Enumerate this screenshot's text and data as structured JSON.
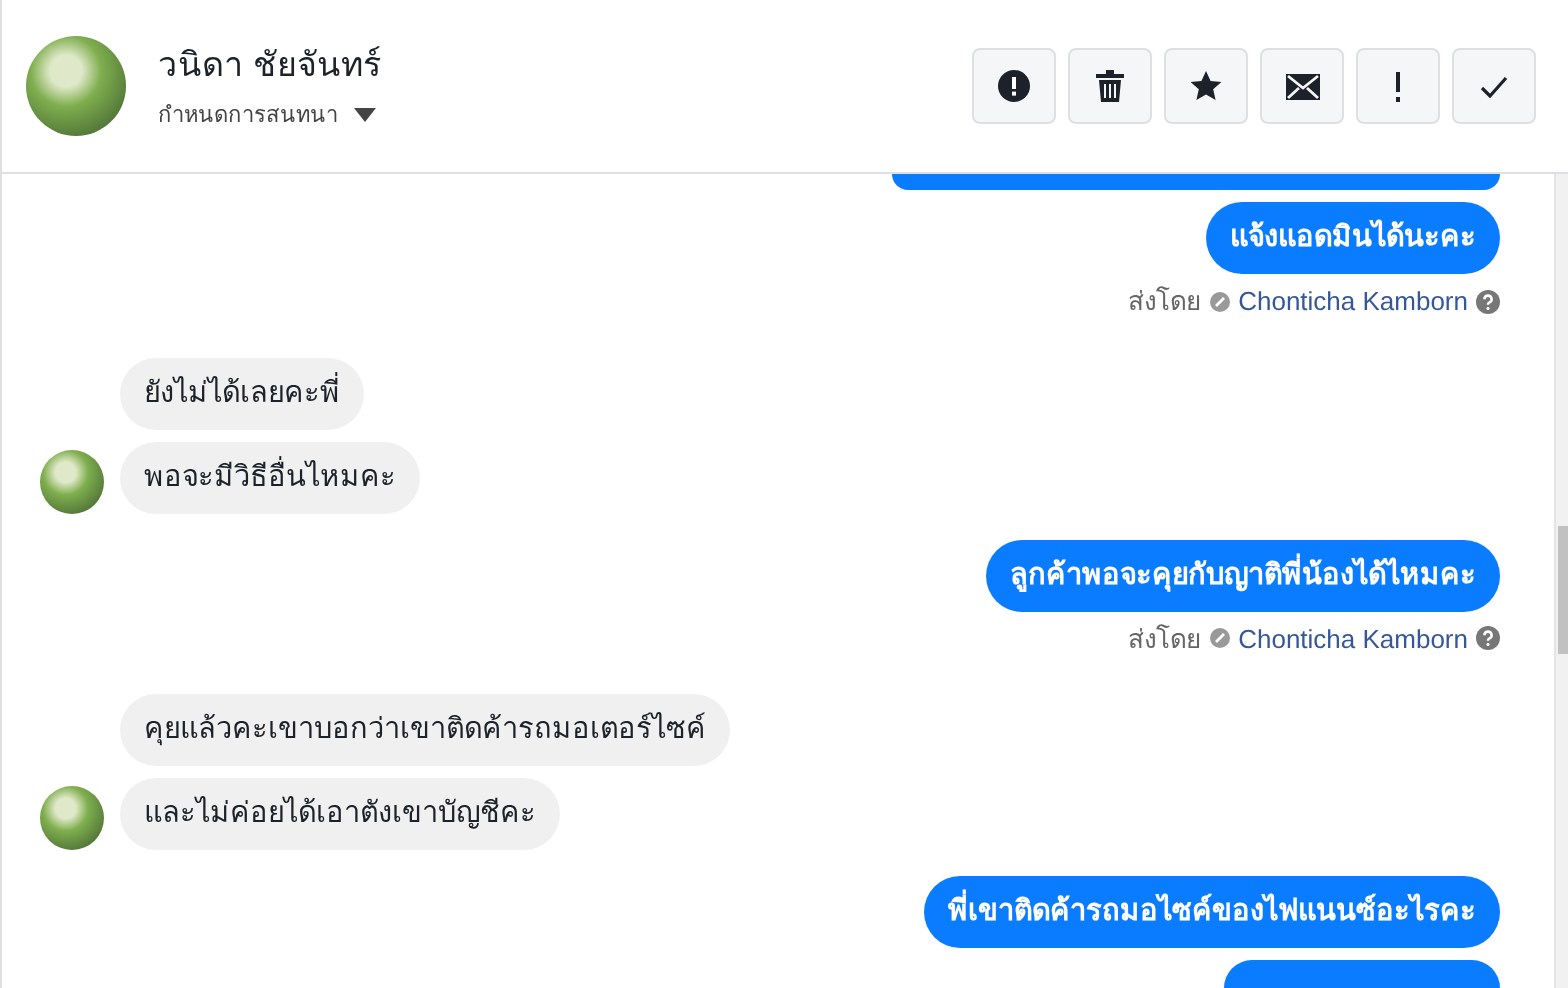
{
  "header": {
    "name": "วนิดา ชัยจันทร์",
    "subtitle": "กำหนดการสนทนา"
  },
  "toolbar": [
    {
      "kind": "alert"
    },
    {
      "kind": "trash"
    },
    {
      "kind": "star"
    },
    {
      "kind": "mail"
    },
    {
      "kind": "exclamation"
    },
    {
      "kind": "check"
    }
  ],
  "messages": [
    {
      "kind": "outgoing_clipped_top"
    },
    {
      "kind": "outgoing",
      "text": "แจ้งแอดมินได้นะคะ"
    },
    {
      "kind": "sent_by",
      "label": "ส่งโดย",
      "author": "Chonticha Kamborn"
    },
    {
      "kind": "incoming",
      "text": "ยังไม่ได้เลยคะพี่",
      "avatar": false
    },
    {
      "kind": "incoming",
      "text": "พอจะมีวิธีอื่นไหมคะ",
      "avatar": true
    },
    {
      "kind": "outgoing",
      "text": "ลูกค้าพอจะคุยกับญาติพี่น้องได้ไหมคะ"
    },
    {
      "kind": "sent_by",
      "label": "ส่งโดย",
      "author": "Chonticha Kamborn"
    },
    {
      "kind": "incoming",
      "text": "คุยแล้วคะเขาบอกว่าเขาติดค้ารถมอเตอร์ไซค์",
      "avatar": false
    },
    {
      "kind": "incoming",
      "text": "และไม่ค่อยได้เอาตังเขาบัญชีคะ",
      "avatar": true
    },
    {
      "kind": "outgoing",
      "text": "พี่เขาติดค้ารถมอไซค์ของไฟแนนซ์อะไรคะ"
    },
    {
      "kind": "outgoing_clipped_bottom"
    }
  ]
}
